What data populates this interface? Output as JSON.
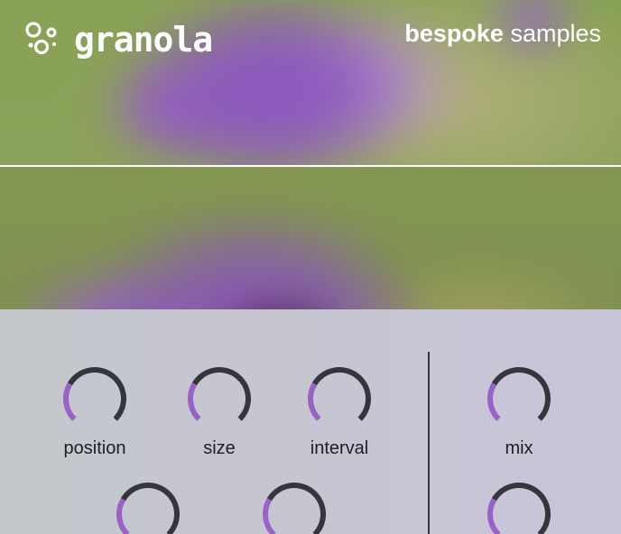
{
  "header": {
    "app_name": "granola",
    "maker_bold": "bespoke",
    "maker_light": "samples",
    "logo_icon": "bubbles-icon"
  },
  "colors": {
    "accent": "#9a62c6",
    "knob_track": "#35363b",
    "text_dark": "#1e1f23",
    "header_text": "#ffffff",
    "panel_bg": "#c6c7d0"
  },
  "knobs": [
    {
      "id": "position",
      "label": "position",
      "value": 0.28,
      "section": "grain"
    },
    {
      "id": "size",
      "label": "size",
      "value": 0.28,
      "section": "grain"
    },
    {
      "id": "interval",
      "label": "interval",
      "value": 0.28,
      "section": "grain"
    },
    {
      "id": "mix",
      "label": "mix",
      "value": 0.28,
      "section": "output"
    },
    {
      "id": "row2-a",
      "label": "",
      "value": 0.28,
      "section": "grain"
    },
    {
      "id": "row2-b",
      "label": "",
      "value": 0.28,
      "section": "grain"
    },
    {
      "id": "row2-c",
      "label": "",
      "value": 0.28,
      "section": "output"
    }
  ]
}
